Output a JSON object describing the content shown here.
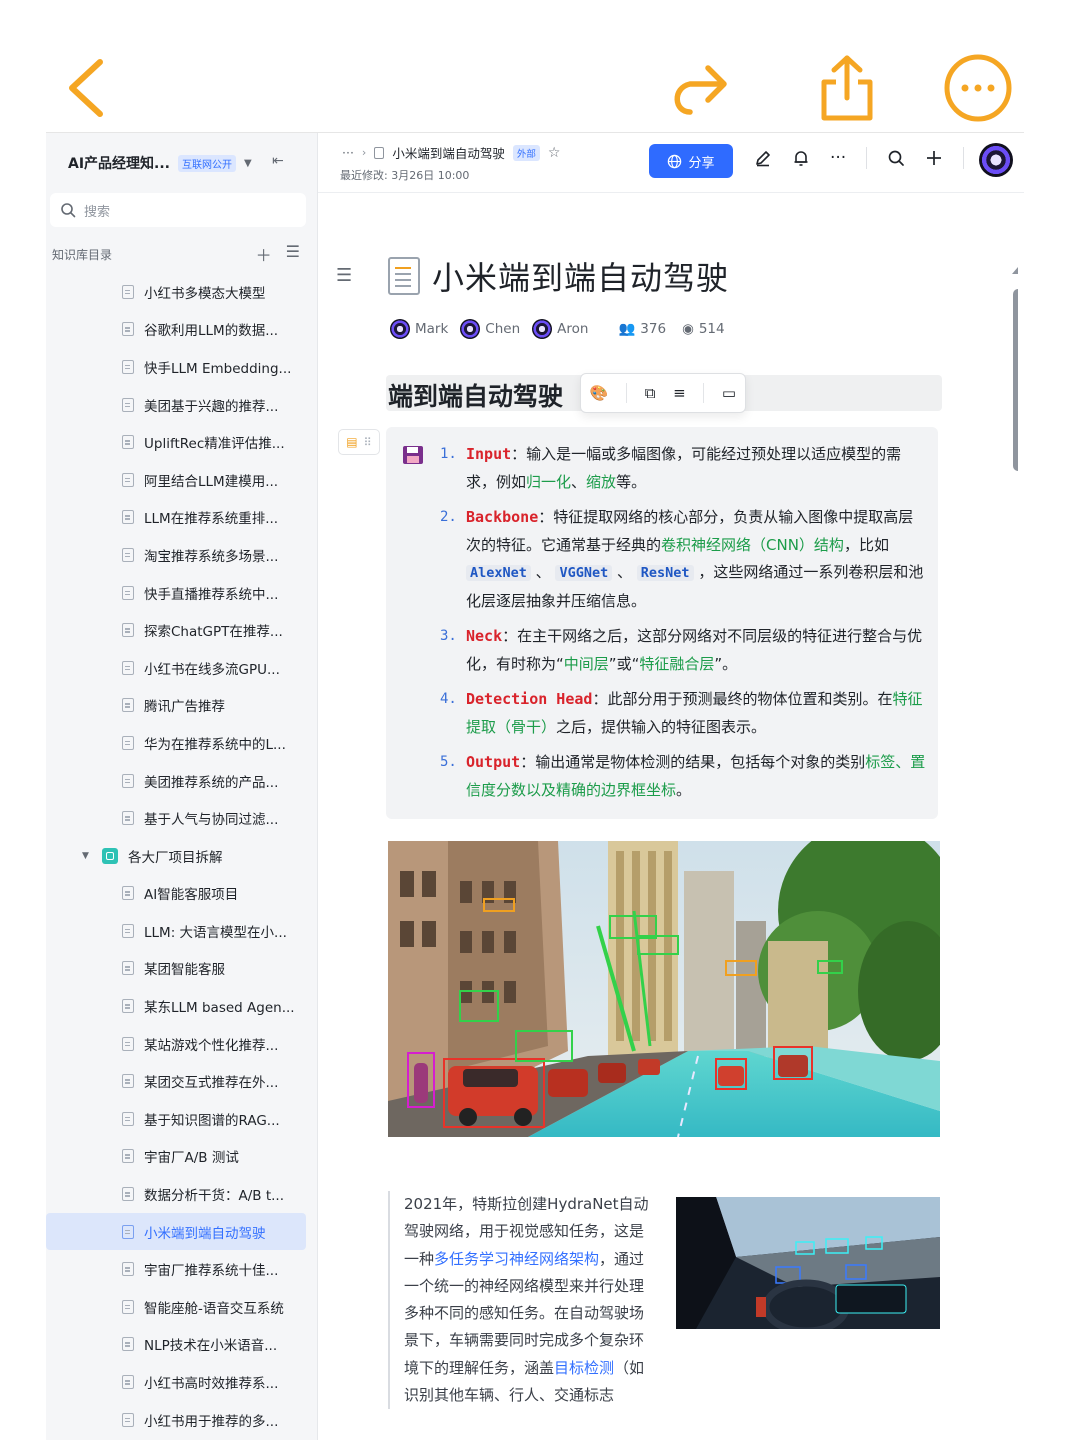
{
  "colors": {
    "accent_orange": "#f5a623",
    "primary_blue": "#2f6bff",
    "keyword_red": "#d9232b",
    "highlight_green": "#1c9c4a"
  },
  "native_bar": {
    "icons": [
      "back-chevron-icon",
      "redo-icon",
      "share-upload-icon",
      "more-circle-icon"
    ]
  },
  "sidebar": {
    "kb_title": "AI产品经理知...",
    "kb_tag": "互联网公开",
    "search_placeholder": "搜索",
    "directory_label": "知识库目录",
    "items": [
      "小红书多模态大模型",
      "谷歌利用LLM的数据...",
      "快手LLM Embedding...",
      "美团基于兴趣的推荐...",
      "UpliftRec精准评估推...",
      "阿里结合LLM建模用...",
      "LLM在推荐系统重排...",
      "淘宝推荐系统多场景...",
      "快手直播推荐系统中...",
      "探索ChatGPT在推荐...",
      "小红书在线多流GPU...",
      "腾讯广告推荐",
      "华为在推荐系统中的L...",
      "美团推荐系统的产品...",
      "基于人气与协同过滤..."
    ],
    "folder": "各大厂项目拆解",
    "folder_items": [
      "AI智能客服项目",
      "LLM: 大语言模型在小...",
      "某团智能客服",
      "某东LLM based Agen...",
      "某站游戏个性化推荐...",
      "某团交互式推荐在外...",
      "基于知识图谱的RAG...",
      "宇宙厂A/B 测试",
      "数据分析干货：A/B t...",
      "小米端到端自动驾驶",
      "宇宙厂推荐系统十佳...",
      "智能座舱-语音交互系统",
      "NLP技术在小米语音...",
      "小红书高时效推荐系...",
      "小红书用于推荐的多..."
    ],
    "active_item": "小米端到端自动驾驶"
  },
  "doc_bar": {
    "more": "···",
    "breadcrumb_title": "小米端到端自动驾驶",
    "external_tag": "外部",
    "modified": "最近修改: 3月26日 10:00",
    "share_label": "分享"
  },
  "doc": {
    "title": "小米端到端自动驾驶",
    "authors": [
      "Mark",
      "Chen",
      "Aron"
    ],
    "collaborators": "376",
    "views": "514",
    "heading": "端到端自动驾驶",
    "list": [
      {
        "num": "1.",
        "key": "Input",
        "text_a": "：输入是一幅或多幅图像，可能经过预处理以适应模型的需求，例如",
        "link_a": "归一化",
        "text_b": "、",
        "link_b": "缩放",
        "text_c": "等。"
      },
      {
        "num": "2.",
        "key": "Backbone",
        "text_a": "：特征提取网络的核心部分，负责从输入图像中提取高层次的特征。它通常基于经典的",
        "link_a": "卷积神经网络（CNN）结构",
        "text_b": "，比如 ",
        "code_a": "AlexNet",
        "sep_a": " 、 ",
        "code_b": "VGGNet",
        "sep_b": " 、 ",
        "code_c": "ResNet",
        "text_c": " ，这些网络通过一系列卷积层和池化层逐层抽象并压缩信息。"
      },
      {
        "num": "3.",
        "key": "Neck",
        "text_a": "：在主干网络之后，这部分网络对不同层级的特征进行整合与优化，有时称为“",
        "link_a": "中间层",
        "text_b": "”或“",
        "link_b": "特征融合层",
        "text_c": "”。"
      },
      {
        "num": "4.",
        "key": "Detection Head",
        "text_a": "：此部分用于预测最终的物体位置和类别。在",
        "link_a": "特征提取（骨干）",
        "text_b": "之后，提供输入的特征图表示。"
      },
      {
        "num": "5.",
        "key": "Output",
        "text_a": "：输出通常是物体检测的结果，包括每个对象的类别",
        "link_a": "标签、置信度分数以及精确的边界框坐标",
        "text_b": "。"
      }
    ],
    "para_a": "2021年，特斯拉创建HydraNet自动驾驶网络，用于视觉感知任务，这是一种",
    "para_link_a": "多任务学习神经网络架构",
    "para_b": "，通过一个统一的神经网络模型来并行处理多种不同的感知任务。在自动驾驶场景下，车辆需要同时完成多个复杂环境下的理解任务，涵盖",
    "para_link_b": "目标检测",
    "para_c": "（如识别其他车辆、行人、交通标志"
  }
}
